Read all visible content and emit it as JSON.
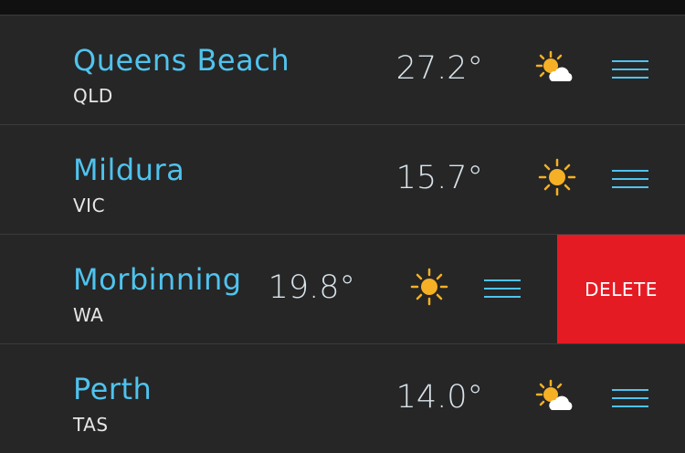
{
  "locations": [
    {
      "city": "Queens Beach",
      "state": "QLD",
      "temperature": "27.2°",
      "icon": "partly-cloudy-icon"
    },
    {
      "city": "Mildura",
      "state": "VIC",
      "temperature": "15.7°",
      "icon": "sun-icon"
    },
    {
      "city": "Morbinning",
      "state": "WA",
      "temperature": "19.8°",
      "icon": "sun-icon",
      "swiped_open": true,
      "delete_label": "DELETE"
    },
    {
      "city": "Perth",
      "state": "TAS",
      "temperature": "14.0°",
      "icon": "partly-cloudy-icon"
    }
  ],
  "colors": {
    "background": "#262626",
    "city_text": "#4fc3ee",
    "sun": "#f5b025",
    "menu_lines": "#4fc3ee",
    "delete": "#e51b24"
  }
}
